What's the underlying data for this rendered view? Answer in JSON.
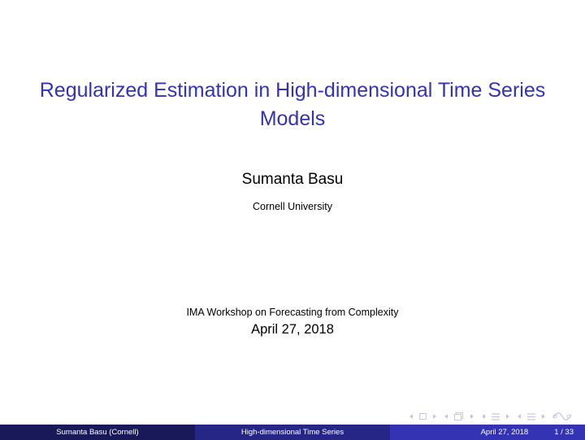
{
  "slide": {
    "title": "Regularized Estimation in High-dimensional Time Series Models",
    "author": "Sumanta Basu",
    "institute": "Cornell University",
    "event": "IMA Workshop on Forecasting from Complexity",
    "date": "April 27, 2018"
  },
  "footer": {
    "author_short": "Sumanta Basu  (Cornell)",
    "title_short": "High-dimensional Time Series",
    "date": "April 27, 2018",
    "page": "1 / 33"
  },
  "navigation": {
    "icons": [
      "frame-back-icon",
      "frame-icon",
      "frame-forward-icon",
      "subsection-back-icon",
      "subsection-icon",
      "subsection-forward-icon",
      "section-back-icon",
      "section-icon",
      "section-forward-icon",
      "document-back-icon",
      "document-icon",
      "document-forward-icon",
      "search-icon"
    ]
  },
  "colors": {
    "title": "#3333b3",
    "footer_left": "#191959",
    "footer_mid": "#262686",
    "footer_right": "#3333b3"
  }
}
